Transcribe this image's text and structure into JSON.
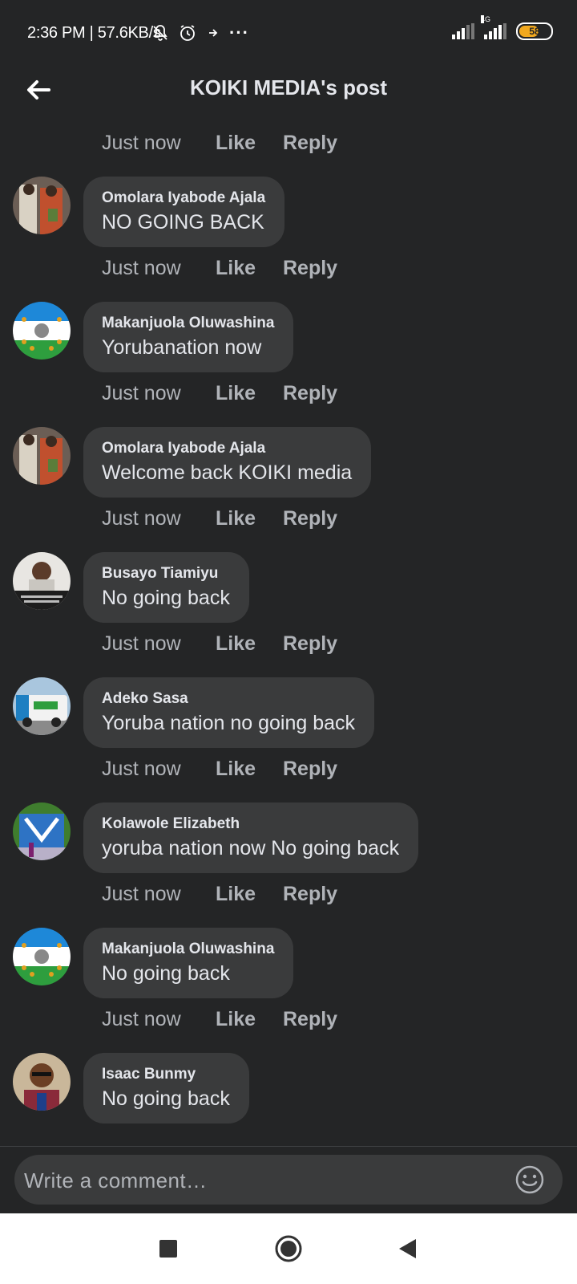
{
  "status_bar": {
    "time_speed": "2:36 PM | 57.6KB/s",
    "network_label": "4G",
    "battery_level": "58",
    "more_icon": "···"
  },
  "header": {
    "title": "KOIKI MEDIA's post"
  },
  "actions": {
    "time": "Just now",
    "like": "Like",
    "reply": "Reply"
  },
  "comments": [
    {
      "author": "Omolara Iyabode Ajala",
      "text": "NO GOING BACK",
      "avatar_icon": "profile-photo"
    },
    {
      "author": "Makanjuola Oluwashina",
      "text": "Yorubanation now",
      "avatar_icon": "flag-emblem"
    },
    {
      "author": "Omolara Iyabode Ajala",
      "text": "Welcome back KOIKI media",
      "avatar_icon": "profile-photo"
    },
    {
      "author": "Busayo Tiamiyu",
      "text": "No going back",
      "avatar_icon": "profile-photo"
    },
    {
      "author": "Adeko Sasa",
      "text": "Yoruba nation no going back",
      "avatar_icon": "vehicle-photo"
    },
    {
      "author": "Kolawole Elizabeth",
      "text": "yoruba nation now No going back",
      "avatar_icon": "poster-photo"
    },
    {
      "author": "Makanjuola Oluwashina",
      "text": "No going back",
      "avatar_icon": "flag-emblem"
    },
    {
      "author": "Isaac Bunmy",
      "text": "No going back",
      "avatar_icon": "profile-photo"
    }
  ],
  "composer": {
    "placeholder": "Write a comment…"
  },
  "colors": {
    "background": "#242526",
    "bubble": "#3a3b3c",
    "secondary_text": "#b0b3b8",
    "primary_text": "#e4e6eb"
  }
}
